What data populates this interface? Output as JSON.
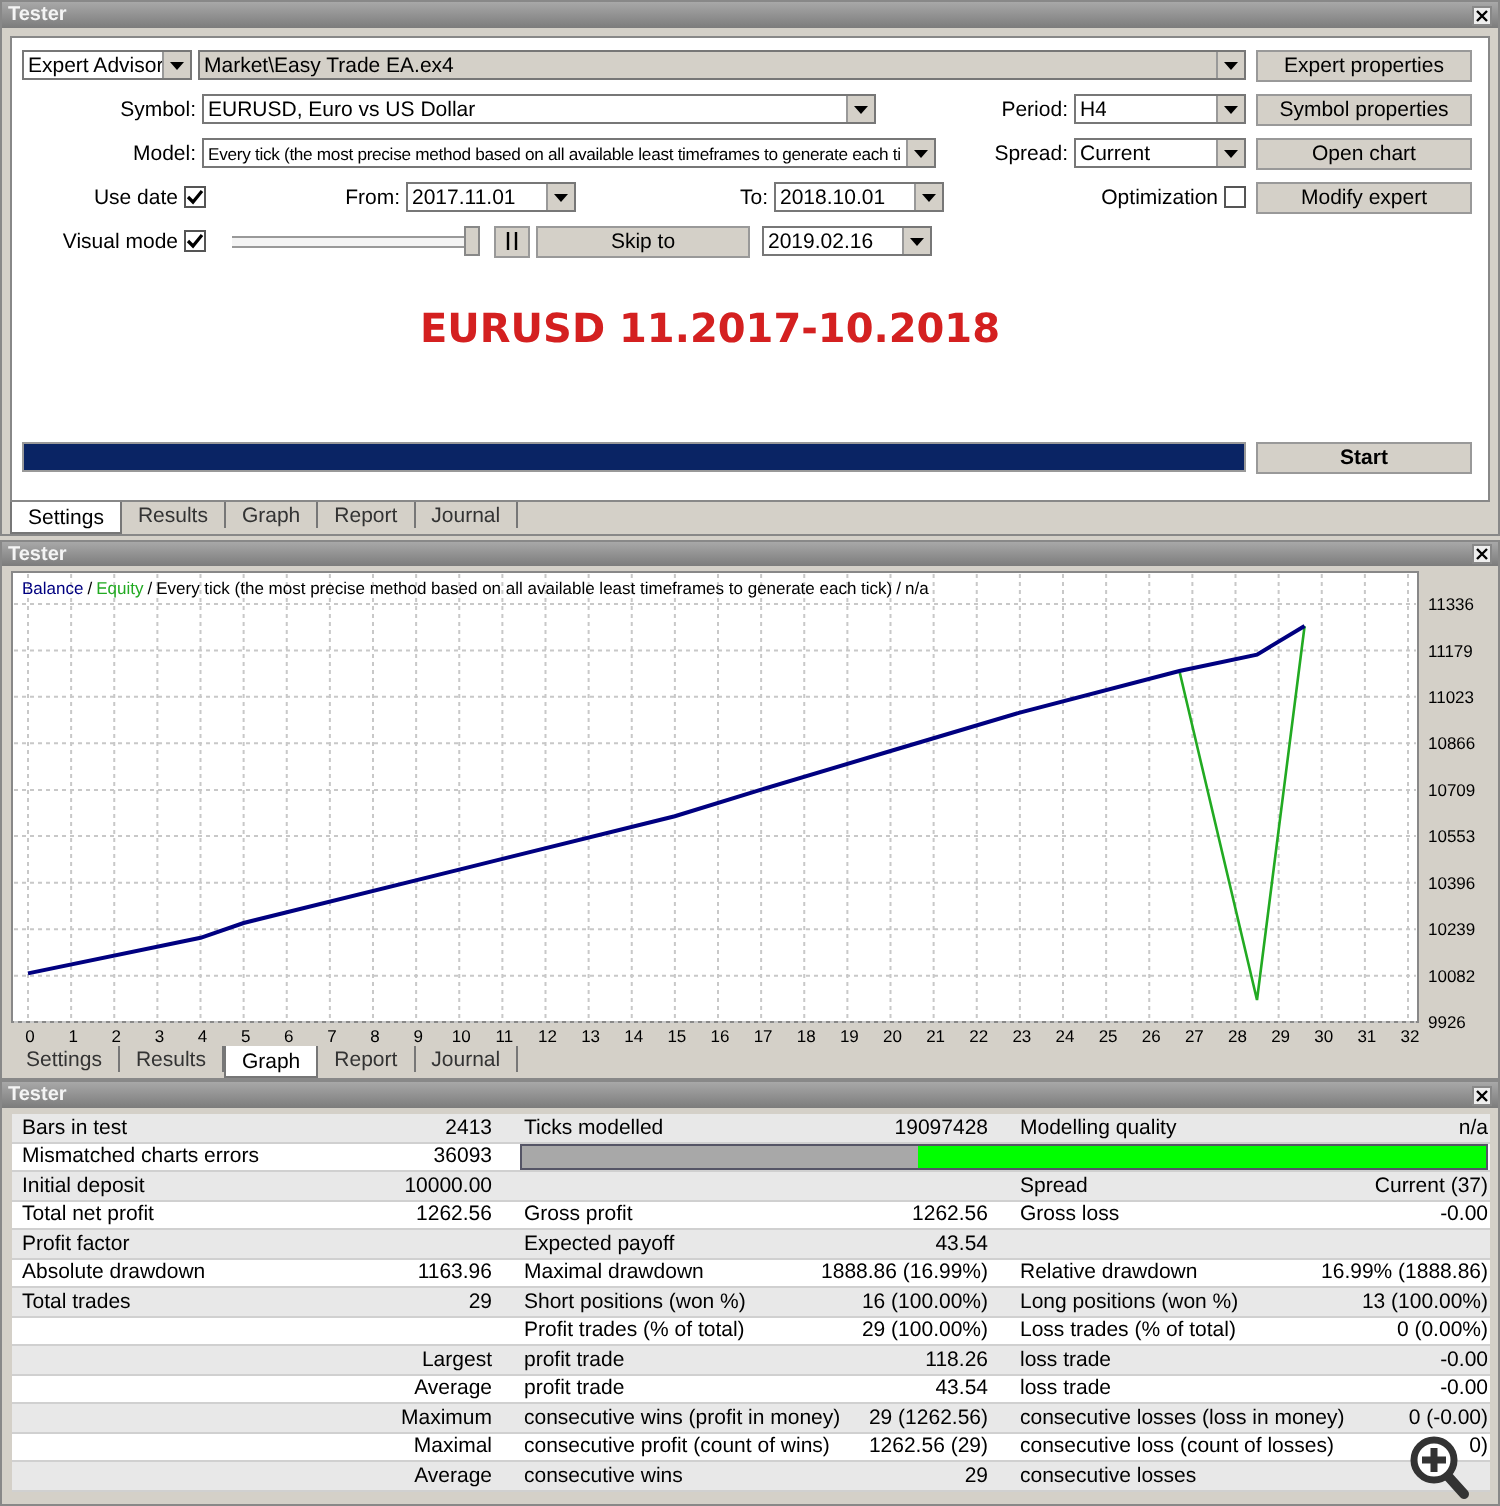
{
  "settings_window": {
    "title": "Tester",
    "expert_type": "Expert Advisor",
    "expert": "Market\\Easy Trade EA.ex4",
    "symbol_label": "Symbol:",
    "symbol": "EURUSD, Euro vs US Dollar",
    "model_label": "Model:",
    "model": "Every tick (the most precise method based on all available least timeframes to generate each ti",
    "period_label": "Period:",
    "period": "H4",
    "spread_label": "Spread:",
    "spread": "Current",
    "use_date": {
      "label": "Use date",
      "checked": true
    },
    "from_label": "From:",
    "from": "2017.11.01",
    "to_label": "To:",
    "to": "2018.10.01",
    "optimization": {
      "label": "Optimization",
      "checked": false
    },
    "visual_mode": {
      "label": "Visual mode",
      "checked": true
    },
    "speed_slider": {
      "level": 1
    },
    "skip_to_button": "Skip to",
    "skip_to_date": "2019.02.16",
    "buttons": [
      "Expert properties",
      "Symbol properties",
      "Open chart",
      "Modify expert"
    ],
    "headline": "EURUSD 11.2017-10.2018",
    "progress": {
      "level": 1
    },
    "start_button": "Start",
    "tabs": [
      {
        "label": "Settings",
        "selected": true
      },
      {
        "label": "Results",
        "selected": false
      },
      {
        "label": "Graph",
        "selected": false
      },
      {
        "label": "Report",
        "selected": false
      },
      {
        "label": "Journal",
        "selected": false
      }
    ]
  },
  "graph_window": {
    "title": "Tester",
    "legend_separator": "/",
    "legend_text": "Every tick (the most precise method based on all available least timeframes to generate each tick)",
    "legend_quality": "n/a",
    "chart_data": {
      "type": "line",
      "x": [
        0,
        4,
        5,
        10,
        15,
        17,
        20,
        23,
        26.7,
        28.5,
        29.6
      ],
      "series": [
        {
          "name": "Balance",
          "color": "#000080",
          "values": [
            10090,
            10210,
            10260,
            10440,
            10620,
            10710,
            10840,
            10970,
            11110,
            11165,
            11262
          ]
        },
        {
          "name": "Equity",
          "color": "#22aa22",
          "values": [
            null,
            null,
            null,
            null,
            null,
            null,
            null,
            null,
            11110,
            10000,
            11262
          ]
        }
      ],
      "grid": true,
      "xlim": [
        0,
        32
      ],
      "ylim": [
        9926,
        11336
      ],
      "xticks": [
        0,
        1,
        2,
        3,
        4,
        5,
        6,
        7,
        8,
        9,
        10,
        11,
        12,
        13,
        14,
        15,
        16,
        17,
        18,
        19,
        20,
        21,
        22,
        23,
        24,
        25,
        26,
        27,
        28,
        29,
        30,
        31,
        32
      ],
      "yticks": [
        9926,
        10082,
        10239,
        10396,
        10553,
        10709,
        10866,
        11023,
        11179,
        11336
      ]
    },
    "tabs": [
      {
        "label": "Settings",
        "selected": false
      },
      {
        "label": "Results",
        "selected": false
      },
      {
        "label": "Graph",
        "selected": true
      },
      {
        "label": "Report",
        "selected": false
      },
      {
        "label": "Journal",
        "selected": false
      }
    ]
  },
  "results_window": {
    "title": "Tester",
    "rows": [
      {
        "kind": "stats",
        "label": "Bars in test",
        "value": "2413",
        "label_2": "Ticks modelled",
        "value_2": "19097428",
        "label_3": "Modelling quality",
        "value_3": "n/a"
      },
      {
        "kind": "bar",
        "label": "Mismatched charts errors",
        "value": "36093",
        "level": 0.59
      },
      {
        "kind": "stats",
        "label": "Initial deposit",
        "value": "10000.00",
        "label_3": "Spread",
        "value_3": "Current (37)"
      },
      {
        "kind": "stats",
        "label": "Total net profit",
        "value": "1262.56",
        "label_2": "Gross profit",
        "value_2": "1262.56",
        "label_3": "Gross loss",
        "value_3": "-0.00"
      },
      {
        "kind": "stats",
        "label": "Profit factor",
        "label_2": "Expected payoff",
        "value_2": "43.54"
      },
      {
        "kind": "stats",
        "label": "Absolute drawdown",
        "value": "1163.96",
        "label_2": "Maximal drawdown",
        "value_2": "1888.86 (16.99%)",
        "label_3": "Relative drawdown",
        "value_3": "16.99% (1888.86)"
      },
      {
        "kind": "stats",
        "label": "Total trades",
        "value": "29",
        "label_2": "Short positions (won %)",
        "value_2": "16 (100.00%)",
        "label_3": "Long positions (won %)",
        "value_3": "13 (100.00%)"
      },
      {
        "kind": "stats",
        "label_2": "Profit trades (% of total)",
        "value_2": "29 (100.00%)",
        "label_3": "Loss trades (% of total)",
        "value_3": "0 (0.00%)"
      },
      {
        "kind": "stats",
        "value": "Largest",
        "label_2": "profit trade",
        "value_2": "118.26",
        "label_3": "loss trade",
        "value_3": "-0.00"
      },
      {
        "kind": "stats",
        "value": "Average",
        "label_2": "profit trade",
        "value_2": "43.54",
        "label_3": "loss trade",
        "value_3": "-0.00"
      },
      {
        "kind": "stats",
        "value": "Maximum",
        "label_2": "consecutive wins (profit in money)",
        "value_2": "29 (1262.56)",
        "label_3": "consecutive losses (loss in money)",
        "value_3": "0 (-0.00)"
      },
      {
        "kind": "stats",
        "value": "Maximal",
        "label_2": "consecutive profit (count of wins)",
        "value_2": "1262.56 (29)",
        "label_3": "consecutive loss (count of losses)",
        "value_3": "0)"
      },
      {
        "kind": "stats",
        "value": "Average",
        "label_2": "consecutive wins",
        "value_2": "29",
        "label_3": "consecutive losses"
      }
    ]
  }
}
